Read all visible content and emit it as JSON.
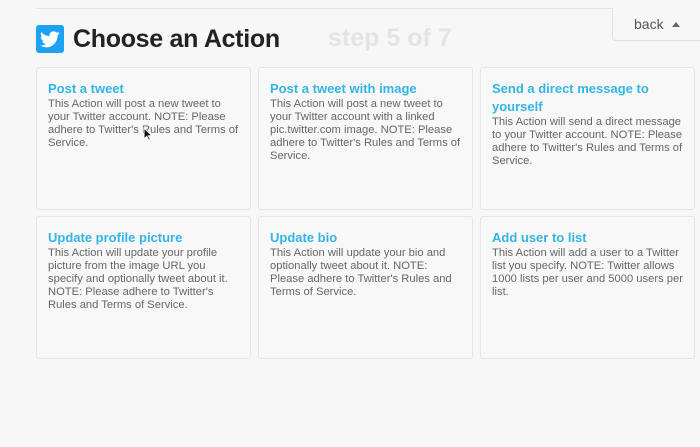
{
  "header": {
    "title": "Choose an Action",
    "step": "step 5 of 7",
    "back_label": "back",
    "logo_icon": "twitter-bird-icon",
    "brand_color": "#1da1f2"
  },
  "actions": [
    {
      "title": "Post a tweet",
      "description": "This Action will post a new tweet to your Twitter account. NOTE: Please adhere to Twitter's Rules and Terms of Service."
    },
    {
      "title": "Post a tweet with image",
      "description": "This Action will post a new tweet to your Twitter account with a linked pic.twitter.com image. NOTE: Please adhere to Twitter's Rules and Terms of Service."
    },
    {
      "title": "Send a direct message to yourself",
      "description": "This Action will send a direct message to your Twitter account. NOTE: Please adhere to Twitter's Rules and Terms of Service."
    },
    {
      "title": "Update profile picture",
      "description": "This Action will update your profile picture from the image URL you specify and optionally tweet about it. NOTE: Please adhere to Twitter's Rules and Terms of Service."
    },
    {
      "title": "Update bio",
      "description": "This Action will update your bio and optionally tweet about it. NOTE: Please adhere to Twitter's Rules and Terms of Service."
    },
    {
      "title": "Add user to list",
      "description": "This Action will add a user to a Twitter list you specify. NOTE: Twitter allows 1000 lists per user and 5000 users per list."
    }
  ],
  "colors": {
    "accent": "#33b5e5",
    "title_text": "#222222",
    "step_text": "#e4e4e4"
  }
}
